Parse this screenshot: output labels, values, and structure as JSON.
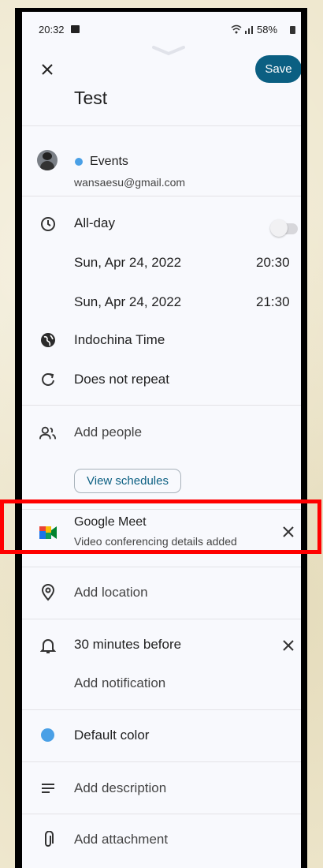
{
  "status_bar": {
    "time": "20:32",
    "battery": "58%"
  },
  "header": {
    "title": "Test",
    "save_label": "Save"
  },
  "account": {
    "calendar": "Events",
    "email": "wansaesu@gmail.com",
    "calendar_color": "#4aa0e6"
  },
  "datetime": {
    "all_day_label": "All-day",
    "all_day_on": false,
    "start_date": "Sun, Apr 24, 2022",
    "start_time": "20:30",
    "end_date": "Sun, Apr 24, 2022",
    "end_time": "21:30",
    "timezone": "Indochina Time",
    "repeat": "Does not repeat"
  },
  "people": {
    "add_label": "Add people",
    "view_schedules_label": "View schedules"
  },
  "meet": {
    "title": "Google Meet",
    "subtitle": "Video conferencing details added"
  },
  "location": {
    "label": "Add location"
  },
  "notification": {
    "reminder": "30 minutes before",
    "add_label": "Add notification"
  },
  "color": {
    "label": "Default color",
    "value": "#4aa0e6"
  },
  "description": {
    "label": "Add description"
  },
  "attachment": {
    "label": "Add attachment"
  },
  "colors": {
    "accent": "#0b5f82",
    "highlight_box": "#ff0000"
  }
}
